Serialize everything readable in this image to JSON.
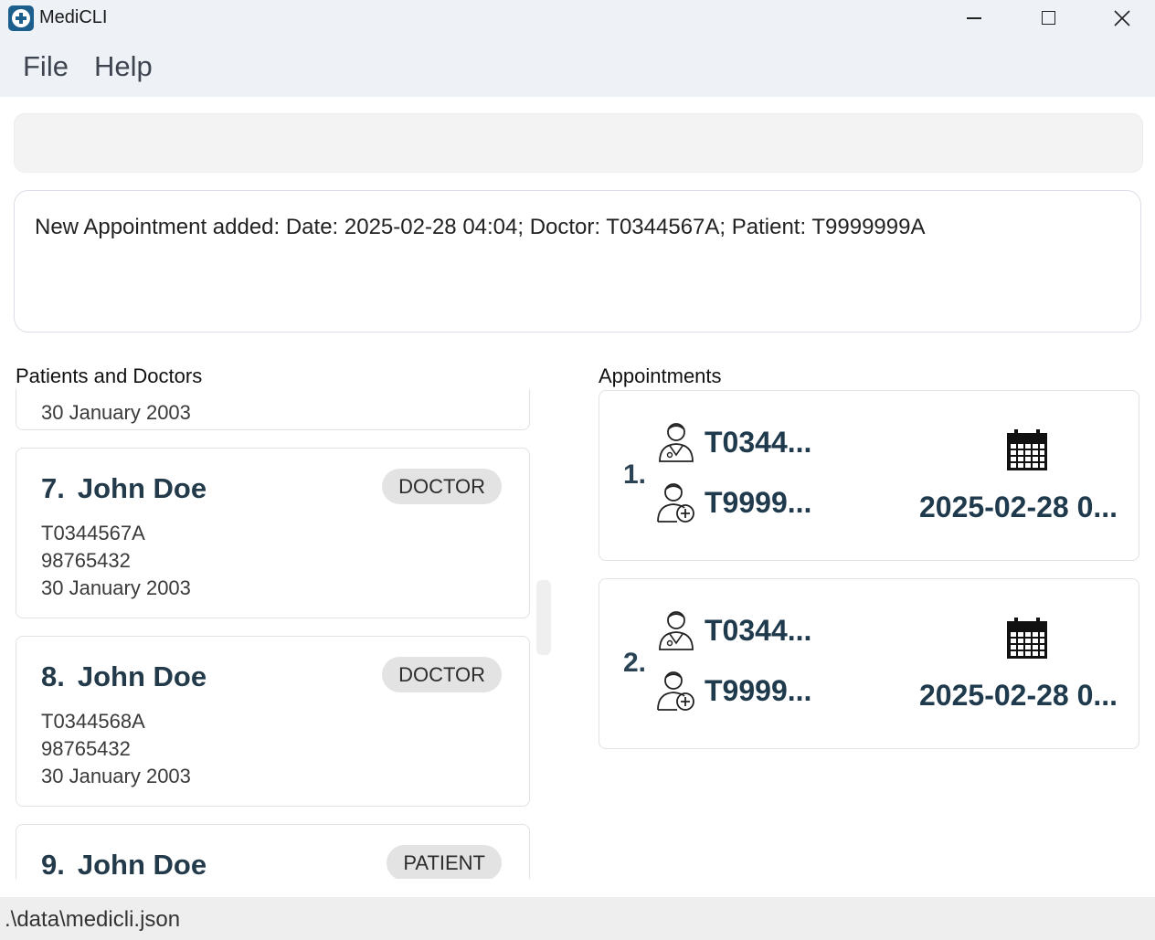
{
  "window": {
    "title": "MediCLI"
  },
  "menu": {
    "file_label": "File",
    "help_label": "Help"
  },
  "command": {
    "value": ""
  },
  "result": {
    "text": "New Appointment added: Date: 2025-02-28 04:04; Doctor: T0344567A; Patient: T9999999A"
  },
  "sections": {
    "people_title": "Patients and Doctors",
    "appointments_title": "Appointments"
  },
  "people": [
    {
      "dob": "30 January 2003"
    },
    {
      "index": "7.",
      "name": "John Doe",
      "role": "DOCTOR",
      "nric": "T0344567A",
      "phone": "98765432",
      "dob": "30 January 2003"
    },
    {
      "index": "8.",
      "name": "John Doe",
      "role": "DOCTOR",
      "nric": "T0344568A",
      "phone": "98765432",
      "dob": "30 January 2003"
    },
    {
      "index": "9.",
      "name": "John Doe",
      "role": "PATIENT"
    }
  ],
  "appointments": [
    {
      "index": "1.",
      "doctor": "T0344...",
      "patient": "T9999...",
      "date": "2025-02-28 0..."
    },
    {
      "index": "2.",
      "doctor": "T0344...",
      "patient": "T9999...",
      "date": "2025-02-28 0..."
    }
  ],
  "status": {
    "path": ".\\data\\medicli.json"
  },
  "icons": {
    "app": "medical-cross-icon",
    "doctor": "doctor-icon",
    "patient": "patient-icon",
    "calendar": "calendar-icon"
  },
  "colors": {
    "title_blue": "#223a4a",
    "badge_bg": "#e3e3e3",
    "chrome_bg": "#eef2f6"
  }
}
